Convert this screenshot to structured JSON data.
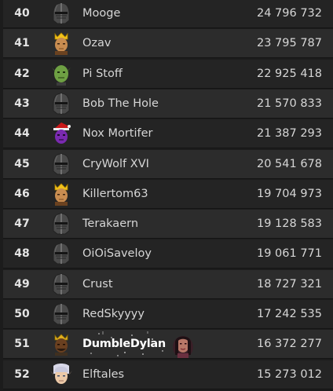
{
  "colors": {
    "row_odd": "#242424",
    "row_even": "#2c2c2c",
    "text": "#d6d6d6",
    "highlight_text": "#ffffff"
  },
  "leaderboard": {
    "rows": [
      {
        "rank": "40",
        "name": "Mooge",
        "score": "24 796 732",
        "avatar": "helmet-icon"
      },
      {
        "rank": "41",
        "name": "Ozav",
        "score": "23 795 787",
        "avatar": "crowned-face-icon"
      },
      {
        "rank": "42",
        "name": "Pi Stoff",
        "score": "22 925 418",
        "avatar": "green-goblin-face-icon"
      },
      {
        "rank": "43",
        "name": "Bob The Hole",
        "score": "21 570 833",
        "avatar": "helmet-icon"
      },
      {
        "rank": "44",
        "name": "Nox Mortifer",
        "score": "21 387 293",
        "avatar": "purple-santa-hat-face-icon"
      },
      {
        "rank": "45",
        "name": "CryWolf XVI",
        "score": "20 541 678",
        "avatar": "helmet-icon"
      },
      {
        "rank": "46",
        "name": "Killertom63",
        "score": "19 704 973",
        "avatar": "crowned-face-icon"
      },
      {
        "rank": "47",
        "name": "Terakaern",
        "score": "19 128 583",
        "avatar": "helmet-icon"
      },
      {
        "rank": "48",
        "name": "OiOiSaveloy",
        "score": "19 061 771",
        "avatar": "helmet-icon"
      },
      {
        "rank": "49",
        "name": "Crust",
        "score": "18 727 321",
        "avatar": "helmet-icon"
      },
      {
        "rank": "50",
        "name": "RedSkyyyy",
        "score": "17 242 535",
        "avatar": "helmet-icon"
      },
      {
        "rank": "51",
        "name": "DumbleDylan",
        "score": "16 372 277",
        "avatar": "dark-crowned-face-icon",
        "highlight": true
      },
      {
        "rank": "52",
        "name": "Elftales",
        "score": "15 273 012",
        "avatar": "elf-face-icon"
      }
    ]
  }
}
